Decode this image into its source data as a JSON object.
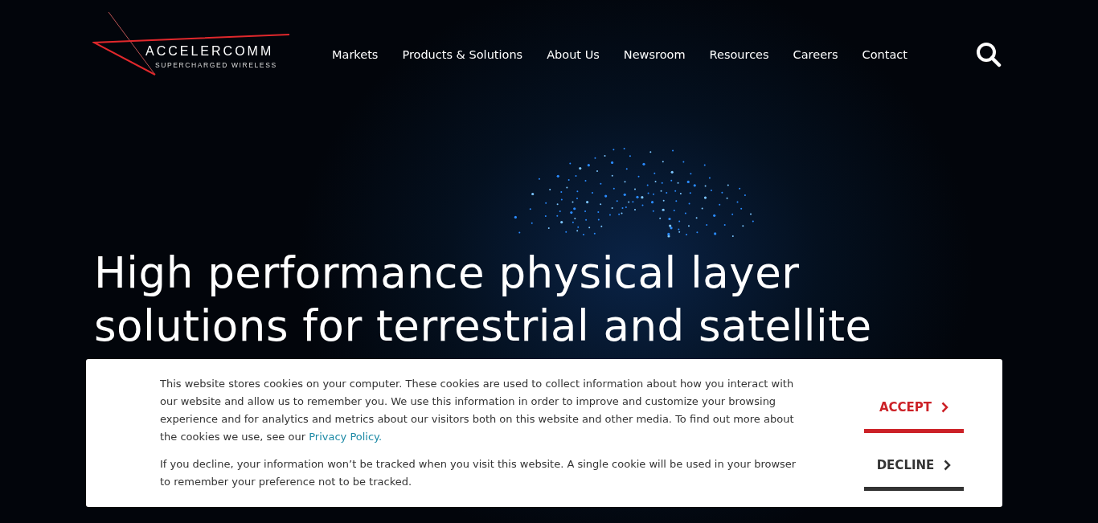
{
  "logo": {
    "name": "ACCELERCOMM",
    "tagline": "SUPERCHARGED WIRELESS"
  },
  "nav": [
    "Markets",
    "Products & Solutions",
    "About Us",
    "Newsroom",
    "Resources",
    "Careers",
    "Contact"
  ],
  "hero": {
    "heading_lines": [
      "High performance physical layer",
      "solutions for terrestrial and satellite"
    ]
  },
  "cookie_banner": {
    "paragraphs": [
      {
        "text": "This website stores cookies on your computer. These cookies are used to collect information about how you interact with our website and allow us to remember you. We use this information in order to improve and customize your browsing experience and for analytics and metrics about our visitors both on this website and other media. To find out more about the cookies we use, see our ",
        "link": "Privacy Policy."
      },
      {
        "text": "If you decline, your information won’t be tracked when you visit this website. A single cookie will be used in your browser to remember your preference not to be tracked."
      }
    ],
    "buttons": [
      {
        "label": "ACCEPT",
        "kind": "primary"
      },
      {
        "label": "DECLINE",
        "kind": "secondary"
      }
    ]
  }
}
